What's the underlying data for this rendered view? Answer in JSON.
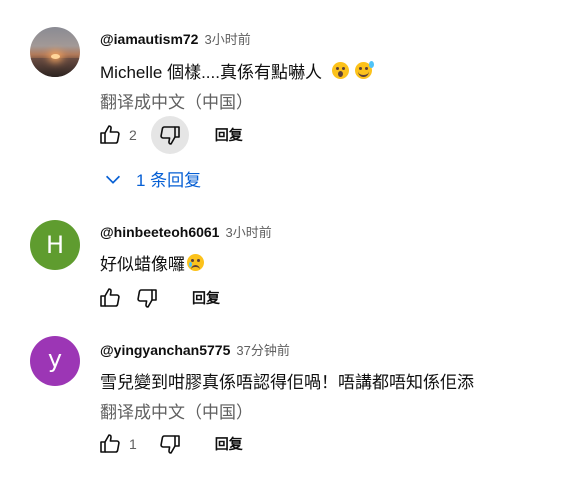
{
  "comments": [
    {
      "author": "@iamautism72",
      "time": "3小时前",
      "text": "Michelle 個樣....真係有點嚇人",
      "emojis": [
        "astonished-face-emoji",
        "grinning-sweat-emoji"
      ],
      "translate": "翻译成中文（中国）",
      "likes": "2",
      "reply_label": "回复",
      "replies": "1 条回复"
    },
    {
      "author": "@hinbeeteoh6061",
      "time": "3小时前",
      "text": "好似蜡像囉",
      "emojis": [
        "crying-face-emoji"
      ],
      "avatar_letter": "H",
      "avatar_color": "#5f9c2f",
      "reply_label": "回复"
    },
    {
      "author": "@yingyanchan5775",
      "time": "37分钟前",
      "text": "雪兒變到咁膠真係唔認得佢喎！唔講都唔知係佢添",
      "avatar_letter": "y",
      "avatar_color": "#9c36b5",
      "translate": "翻译成中文（中国）",
      "likes": "1",
      "reply_label": "回复"
    }
  ]
}
